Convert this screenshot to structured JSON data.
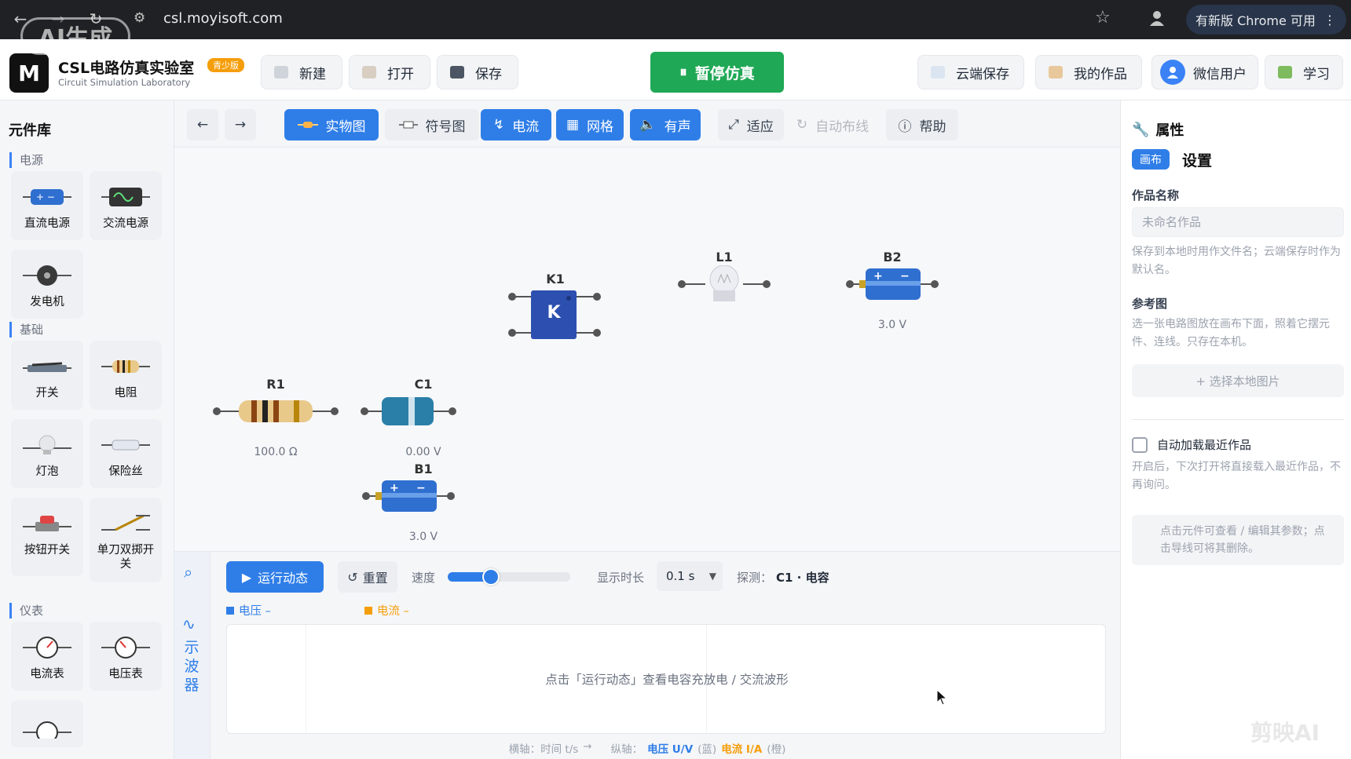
{
  "browser": {
    "url": "csl.moyisoft.com",
    "update_label": "有新版 Chrome 可用",
    "watermark": "AI生成"
  },
  "app": {
    "logo_text": "M",
    "title": "CSL电路仿真实验室",
    "subtitle": "Circuit Simulation Laboratory",
    "badge": "青少版",
    "buttons": {
      "new": "新建",
      "open": "打开",
      "save": "保存",
      "pause": "暂停仿真",
      "cloud_save": "云端保存",
      "my_works": "我的作品",
      "user": "微信用户",
      "learn": "学习"
    }
  },
  "library": {
    "title": "元件库",
    "sections": [
      {
        "label": "电源",
        "items": [
          "直流电源",
          "交流电源",
          "发电机"
        ]
      },
      {
        "label": "基础",
        "items": [
          "开关",
          "电阻",
          "灯泡",
          "保险丝",
          "按钮开关",
          "单刀双掷开关"
        ]
      },
      {
        "label": "仪表",
        "items": [
          "电流表",
          "电压表"
        ]
      }
    ]
  },
  "toolbar": {
    "physical": "实物图",
    "symbol": "符号图",
    "current": "电流",
    "grid": "网格",
    "sound": "有声",
    "fit": "适应",
    "auto_route": "自动布线",
    "help": "帮助"
  },
  "canvas": {
    "components": [
      {
        "id": "K1",
        "value": "",
        "text": "K"
      },
      {
        "id": "L1",
        "value": ""
      },
      {
        "id": "B2",
        "value": "3.0 V"
      },
      {
        "id": "R1",
        "value": "100.0 Ω"
      },
      {
        "id": "C1",
        "value": "0.00 V"
      },
      {
        "id": "B1",
        "value": "3.0 V"
      }
    ]
  },
  "properties": {
    "title": "属性",
    "tab_badge": "画布",
    "settings": "设置",
    "work_name_label": "作品名称",
    "work_name_placeholder": "未命名作品",
    "work_name_hint": "保存到本地时用作文件名；云端保存时作为默认名。",
    "ref_label": "参考图",
    "ref_hint": "选一张电路图放在画布下面，照着它摆元件、连线。只存在本机。",
    "choose_image": "+ 选择本地图片",
    "auto_load_label": "自动加载最近作品",
    "auto_load_hint": "开启后，下次打开将直接载入最近作品，不再询问。",
    "tip": "点击元件可查看 / 编辑其参数；点击导线可将其删除。"
  },
  "oscilloscope": {
    "side_label": "示波器",
    "run": "运行动态",
    "reset": "重置",
    "speed_label": "速度",
    "speed_fraction": 0.35,
    "duration_label": "显示时长",
    "duration_value": "0.1 s",
    "probe_label": "探测：",
    "probe_value": "C1 · 电容",
    "legend_voltage": "电压 –",
    "legend_current": "电流 –",
    "voltage_color": "#2f7ee8",
    "current_color": "#f59e0b",
    "placeholder": "点击「运行动态」查看电容充放电 / 交流波形",
    "axis_x": "横轴：时间 t/s",
    "axis_arrow": "→",
    "axis_y": "纵轴：",
    "axis_v": "电压 U/V",
    "axis_v_note": "(蓝)",
    "axis_i": "电流 I/A",
    "axis_i_note": "(橙)"
  },
  "watermark_br": "剪映AI"
}
